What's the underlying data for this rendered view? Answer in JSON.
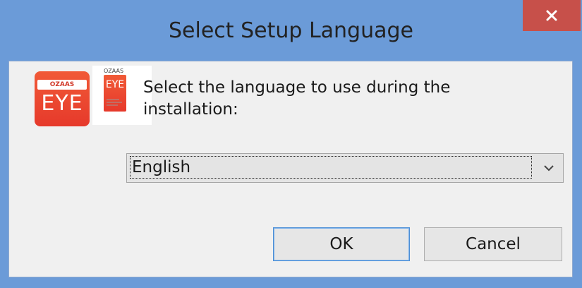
{
  "window": {
    "title": "Select Setup Language",
    "colors": {
      "frame": "#6b9bd8",
      "close": "#c7504a",
      "client": "#f0f0f0"
    }
  },
  "icons": {
    "app_icon": "ozaas-eye-app-icon",
    "logo": "ozaas-eye-logo-image",
    "close": "close-icon",
    "dropdown": "chevron-down-icon"
  },
  "app_icon": {
    "brand": "OZAAS",
    "name": "EYE"
  },
  "logo_image": {
    "brand": "OZAAS",
    "name": "EYE"
  },
  "prompt": "Select the language to use during the installation:",
  "language_select": {
    "selected": "English"
  },
  "buttons": {
    "ok": "OK",
    "cancel": "Cancel"
  }
}
